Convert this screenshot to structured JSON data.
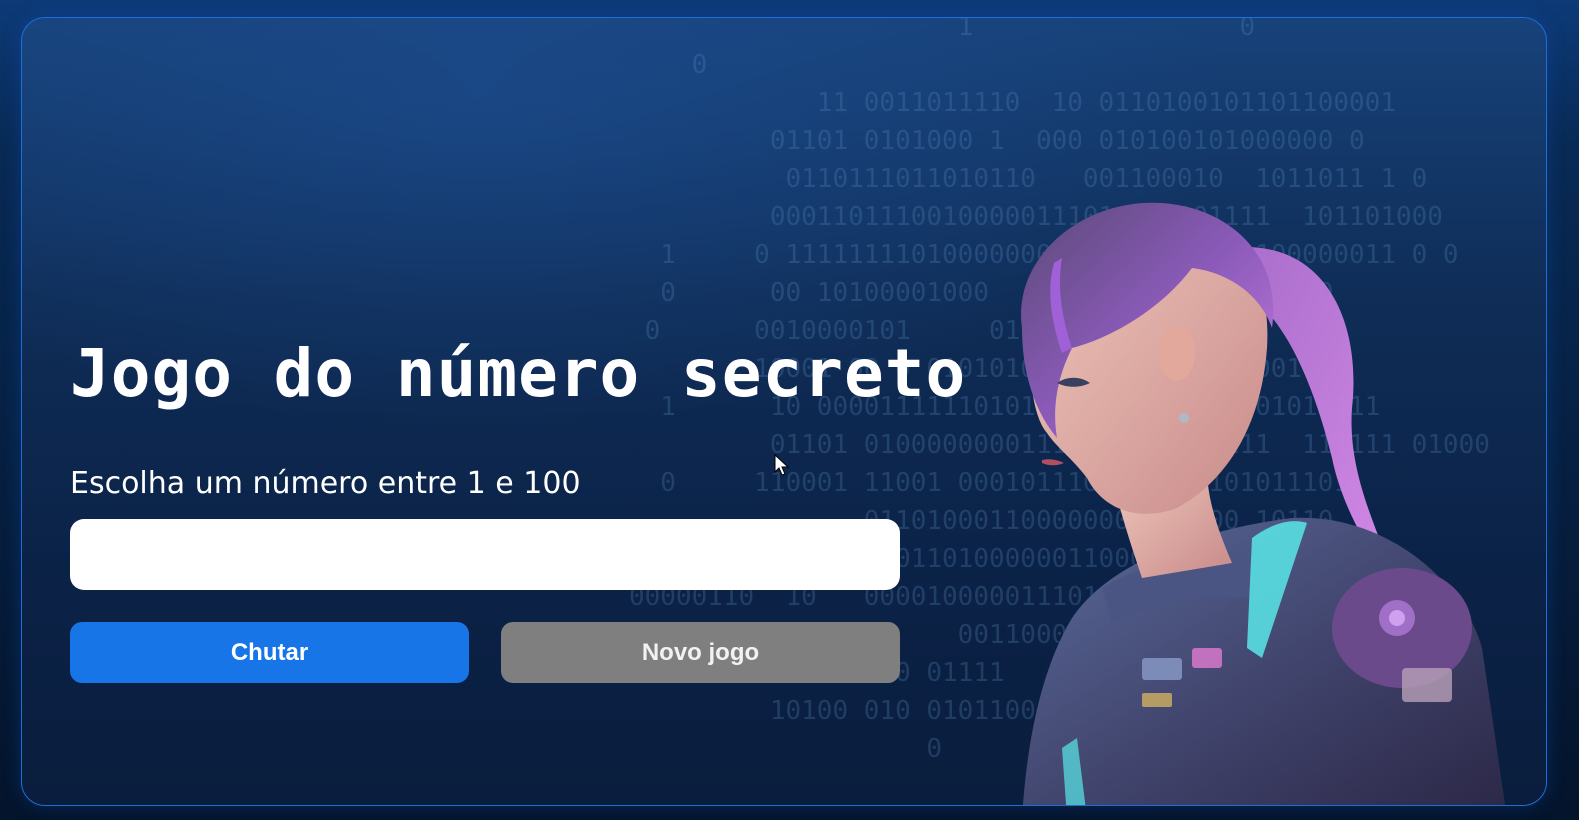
{
  "game": {
    "title": "Jogo do número secreto",
    "subtitle": "Escolha um número entre 1 e 100",
    "input_value": "",
    "buttons": {
      "guess_label": "Chutar",
      "new_game_label": "Novo jogo"
    }
  },
  "background": {
    "binary_rows": [
      "                        1                 0",
      "       0",
      "               11 0011011110  10 0110100101101100001",
      "            01101 0101000 1  000 010100101000000 0",
      "             0110111011010110   001100010  1011011 1 0",
      "            0001101110010000011101 000101111  101101000",
      "     1     0 11111111010000000     00110001100000011 0 0",
      "     0      00 10100001000     0111001101      0",
      "    0      0010000101     01110000000000001",
      "           10001 00 0 01010101110100 011010001",
      "     1      10 000011111101010  0111011110101010111",
      "            01101 01000000001111111010101111  111111 01000",
      "     0     110001 11001 0001011100100001101011101",
      "                  011010001100000001111000 10110",
      "            01000001011010000001100001110101011",
      "   00000110  10   000010000011101011101001010010011",
      "                        0011000011101100",
      "                   00 01111   1011011101101111   1011",
      "            10100 010 01011000101101101101001 01100",
      "                      0"
    ]
  },
  "colors": {
    "primary_button": "#1875e8",
    "secondary_button": "#7f7f7f",
    "border_accent": "#1f6ed8"
  },
  "icons": {
    "cursor": "mouse-pointer-icon",
    "illustration": "cyberpunk-woman-illustration"
  }
}
